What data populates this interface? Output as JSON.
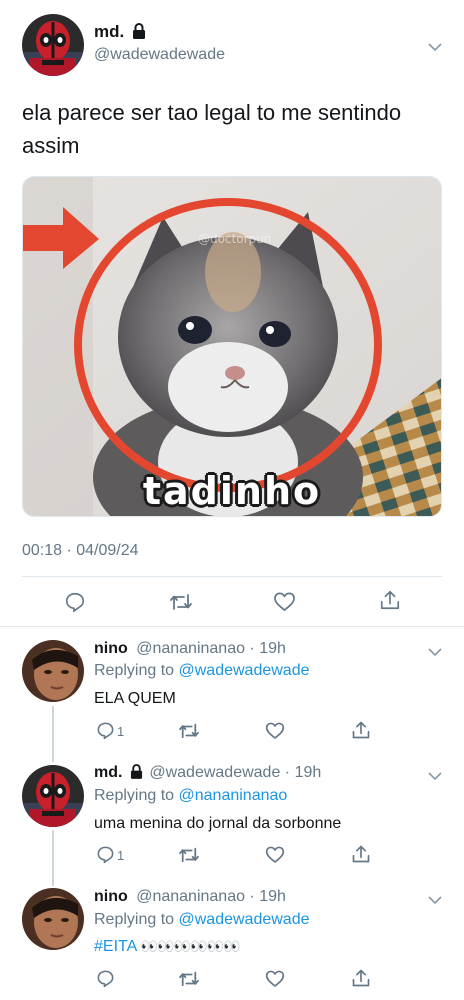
{
  "main_tweet": {
    "display_name": "md.",
    "handle": "@wadewadewade",
    "text_line1": "ela parece ser tao legal to me sentindo",
    "text_line2": "assim",
    "image_caption": "tadinho",
    "image_watermark": "@doctorpun",
    "timestamp": "00:18 · 04/09/24"
  },
  "replies": [
    {
      "display_name": "nino",
      "handle_time": "@nananinanao · 19h",
      "replying_prefix": "Replying to",
      "replying_to": "@wadewadewade",
      "text": "ELA QUEM",
      "reply_count": "1"
    },
    {
      "display_name": "md.",
      "handle_time": "@wadewadewade · 19h",
      "replying_prefix": "Replying to",
      "replying_to": "@nananinanao",
      "text": "uma menina do jornal da sorbonne",
      "reply_count": "1"
    },
    {
      "display_name": "nino",
      "handle_time": "@nananinanao · 19h",
      "replying_prefix": "Replying to",
      "replying_to": "@wadewadewade",
      "hashtag": "#EITA",
      "emoji": "👀👀👀👀👀👀",
      "reply_count": ""
    }
  ],
  "icons": [
    "reply-icon",
    "retweet-icon",
    "like-icon",
    "share-icon",
    "lock-icon",
    "chevron-down-icon"
  ],
  "colors": {
    "link": "#1b95e0",
    "muted": "#657786",
    "separator": "#e1e8ed",
    "annotation_red": "#e4472f"
  }
}
